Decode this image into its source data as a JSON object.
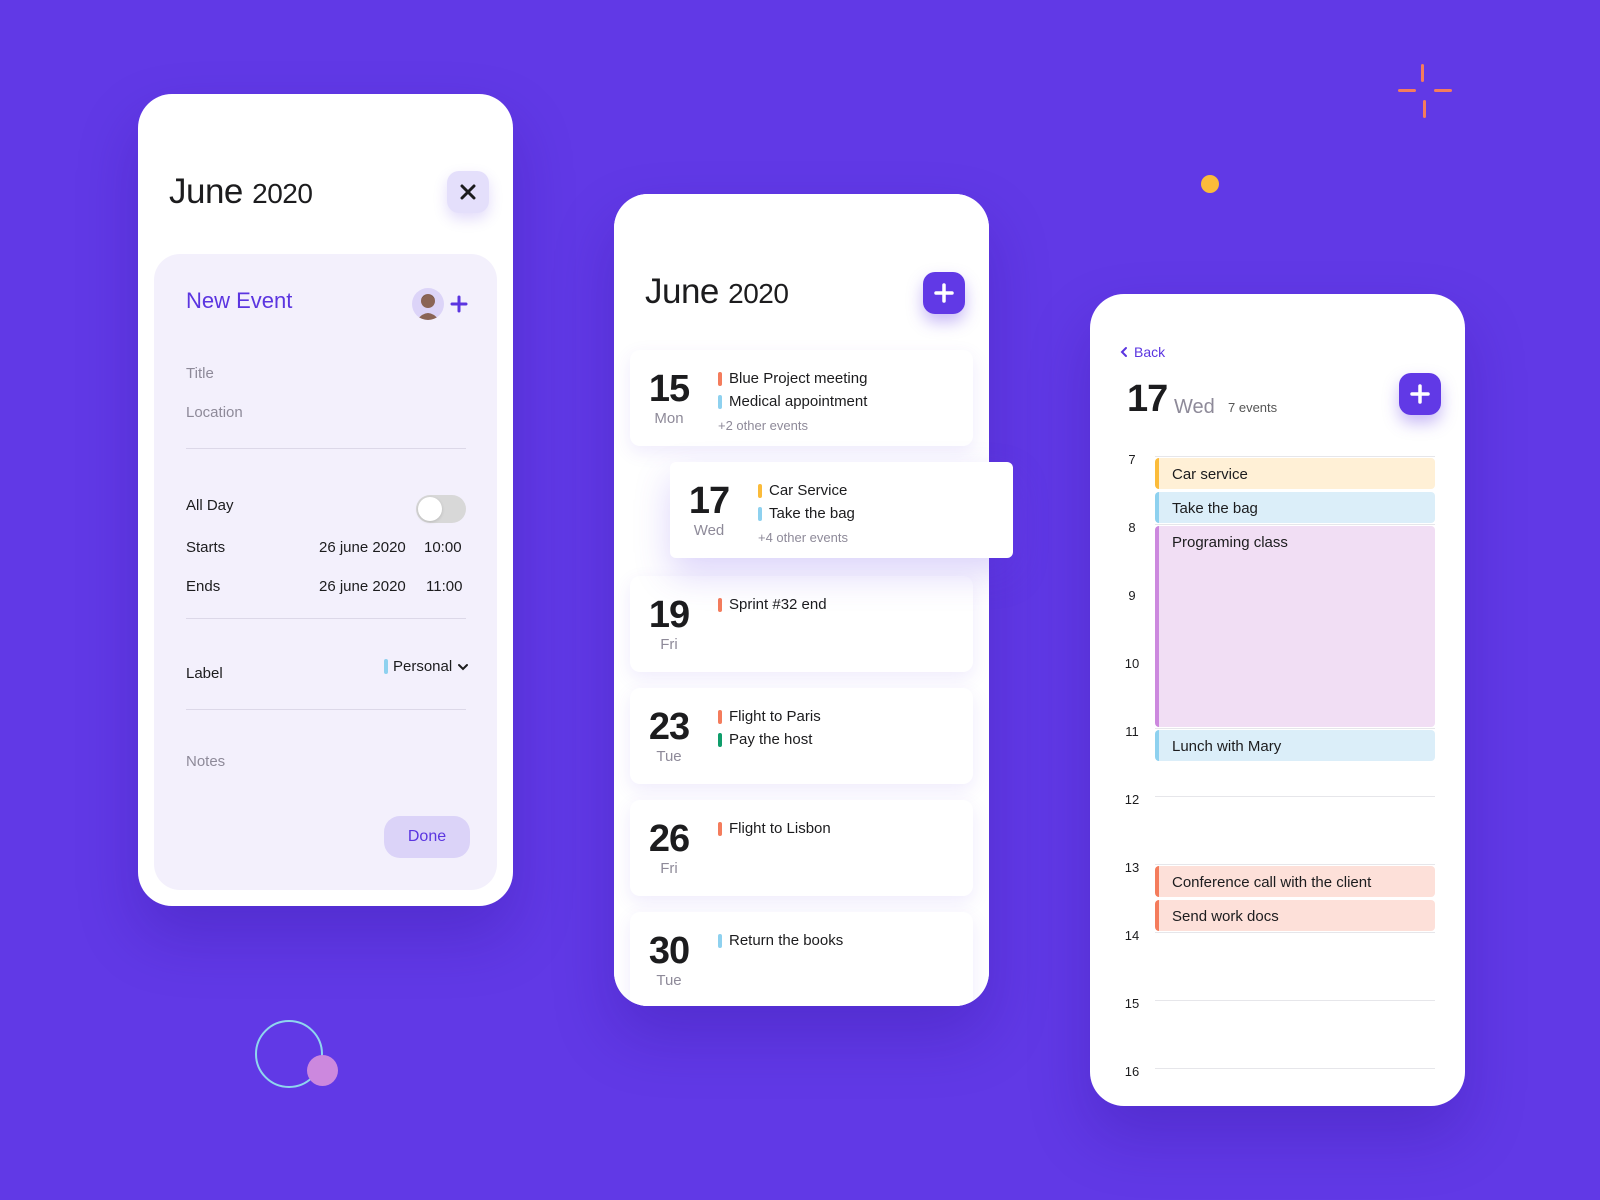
{
  "colors": {
    "background": "#6139e6",
    "accent": "#5b35e0",
    "orange": "#f47c5c",
    "blue": "#8ed1ef",
    "yellow": "#fbbb3a",
    "green": "#0f9d6b",
    "purple": "#cc88de"
  },
  "new_event_screen": {
    "month": "June",
    "year": "2020",
    "close_icon": "close-icon",
    "form": {
      "title": "New Event",
      "avatar_icon": "person-avatar",
      "add_person_icon": "plus-icon",
      "title_placeholder": "Title",
      "location_placeholder": "Location",
      "all_day_label": "All Day",
      "all_day_on": false,
      "starts_label": "Starts",
      "starts_date": "26 june 2020",
      "starts_time": "10:00",
      "ends_label": "Ends",
      "ends_date": "26 june 2020",
      "ends_time": "11:00",
      "label_label": "Label",
      "label_value": "Personal",
      "label_color": "#8ed1ef",
      "notes_placeholder": "Notes",
      "done_label": "Done"
    }
  },
  "month_list_screen": {
    "month": "June",
    "year": "2020",
    "add_icon": "plus-icon",
    "days": [
      {
        "num": "15",
        "name": "Mon",
        "events": [
          {
            "title": "Blue Project meeting",
            "color": "#f47c5c"
          },
          {
            "title": "Medical appointment",
            "color": "#8ed1ef"
          }
        ],
        "more": "+2 other events"
      },
      {
        "num": "17",
        "name": "Wed",
        "events": [
          {
            "title": "Car Service",
            "color": "#fbbb3a"
          },
          {
            "title": "Take the bag",
            "color": "#8ed1ef"
          }
        ],
        "more": "+4 other events"
      },
      {
        "num": "19",
        "name": "Fri",
        "events": [
          {
            "title": "Sprint #32 end",
            "color": "#f47c5c"
          }
        ],
        "more": ""
      },
      {
        "num": "23",
        "name": "Tue",
        "events": [
          {
            "title": "Flight to Paris",
            "color": "#f47c5c"
          },
          {
            "title": "Pay the host",
            "color": "#0f9d6b"
          }
        ],
        "more": ""
      },
      {
        "num": "26",
        "name": "Fri",
        "events": [
          {
            "title": "Flight to Lisbon",
            "color": "#f47c5c"
          }
        ],
        "more": ""
      },
      {
        "num": "30",
        "name": "Tue",
        "events": [
          {
            "title": "Return the books",
            "color": "#8ed1ef"
          }
        ],
        "more": ""
      }
    ]
  },
  "day_screen": {
    "back_label": "Back",
    "day_num": "17",
    "day_name": "Wed",
    "event_count": "7 events",
    "add_icon": "plus-icon",
    "hours": [
      "7",
      "8",
      "9",
      "10",
      "11",
      "12",
      "13",
      "14",
      "15",
      "16"
    ],
    "events": [
      {
        "title": "Car service",
        "start": 7.0,
        "end": 7.5,
        "bar": "#fbbb3a",
        "bg": "#fff0d6"
      },
      {
        "title": "Take the bag",
        "start": 7.5,
        "end": 8.0,
        "bar": "#8ed1ef",
        "bg": "#dbeef9"
      },
      {
        "title": "Programing class",
        "start": 8.0,
        "end": 11.0,
        "bar": "#cc88de",
        "bg": "#f1def4"
      },
      {
        "title": "Lunch with Mary",
        "start": 11.0,
        "end": 11.5,
        "bar": "#8ed1ef",
        "bg": "#dbeef9"
      },
      {
        "title": "Conference call with the client",
        "start": 13.0,
        "end": 13.5,
        "bar": "#f47c5c",
        "bg": "#fde0d9"
      },
      {
        "title": "Send work docs",
        "start": 13.5,
        "end": 14.0,
        "bar": "#f47c5c",
        "bg": "#fde0d9"
      }
    ]
  }
}
